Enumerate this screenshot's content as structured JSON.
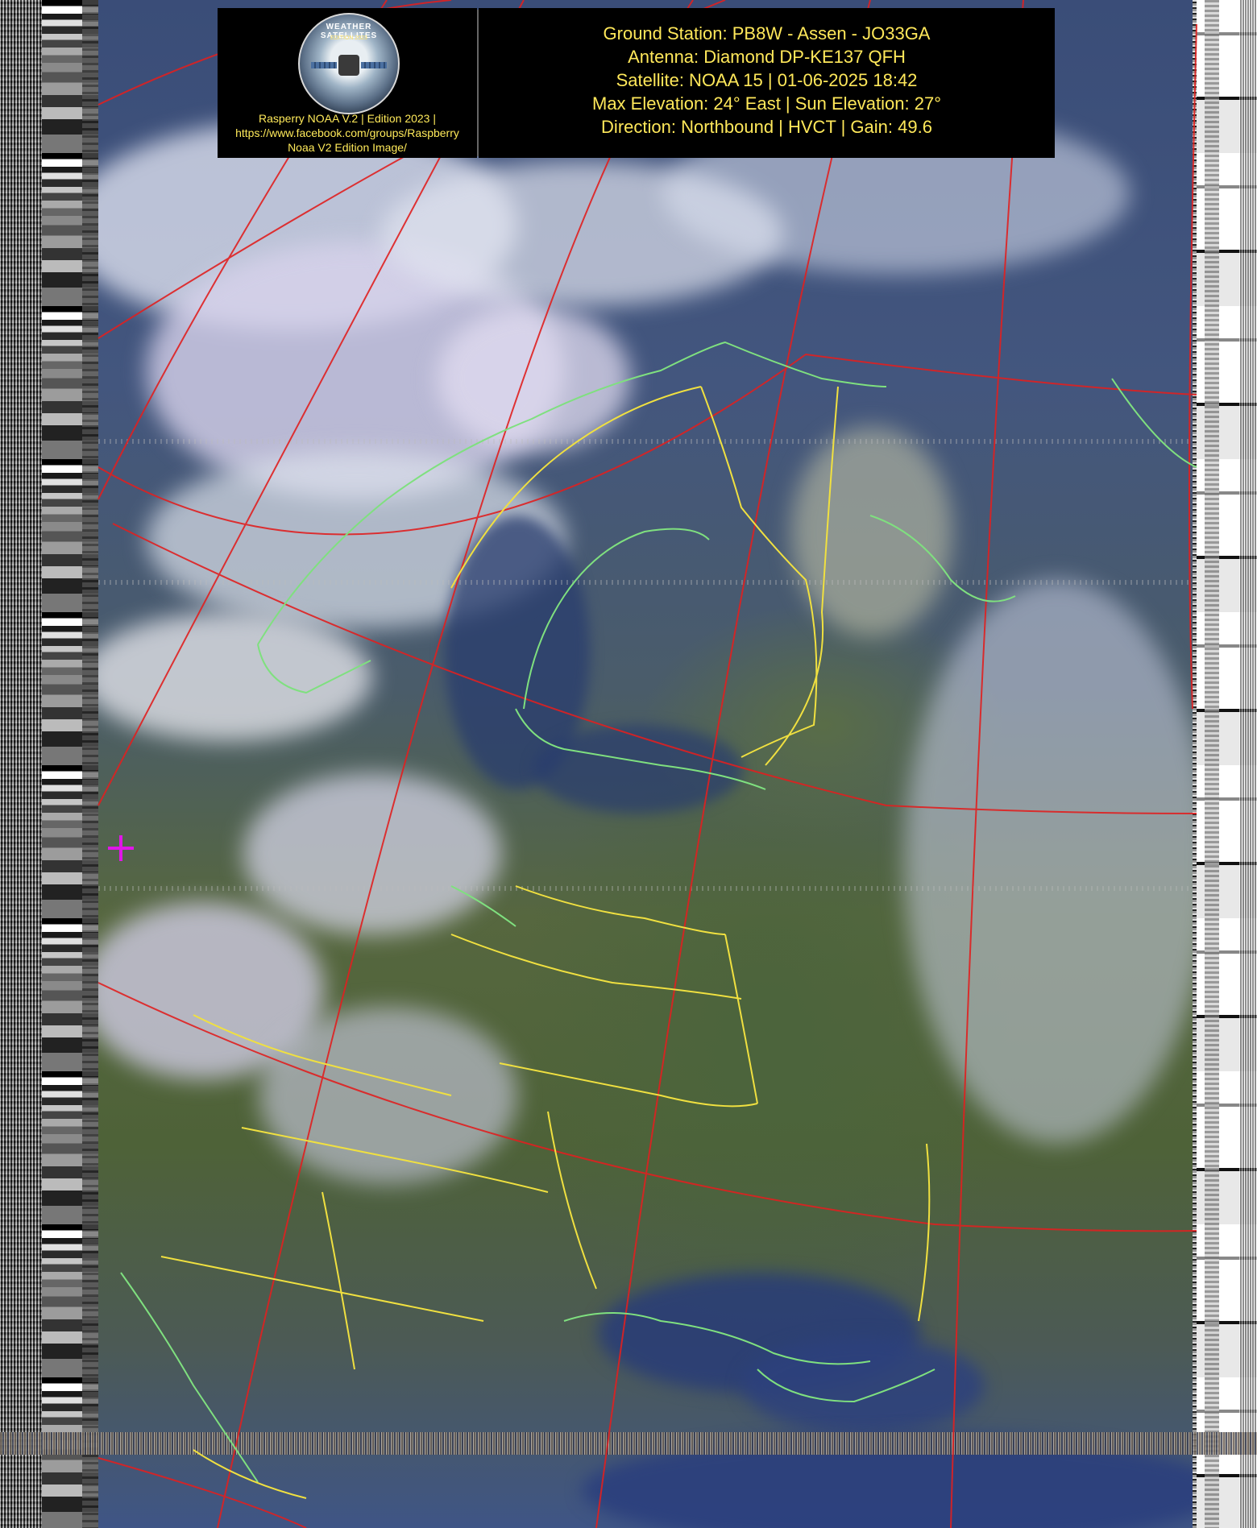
{
  "header": {
    "logo": {
      "text": "WEATHER SATELLITES",
      "subtext": "EDITION 2023"
    },
    "credit_lines": [
      "Rasperry NOAA V.2 | Edition 2023 |",
      "https://www.facebook.com/groups/Raspberry",
      "Noaa V2 Edition Image/"
    ],
    "info_lines": [
      "Ground Station: PB8W - Assen - JO33GA",
      "Antenna: Diamond DP-KE137 QFH",
      "Satellite: NOAA 15 | 01-06-2025 18:42",
      "Max Elevation: 24° East | Sun Elevation: 27°",
      "Direction: Northbound | HVCT | Gain: 49.6"
    ]
  },
  "colors": {
    "header_text": "#ffe85a",
    "graticule": "#e02020",
    "coastline": "#7fe07f",
    "border": "#f0e040",
    "marker": "#e016e8"
  },
  "icons": {
    "logo": "weather-satellites-logo",
    "marker": "ground-station-cross-icon"
  }
}
